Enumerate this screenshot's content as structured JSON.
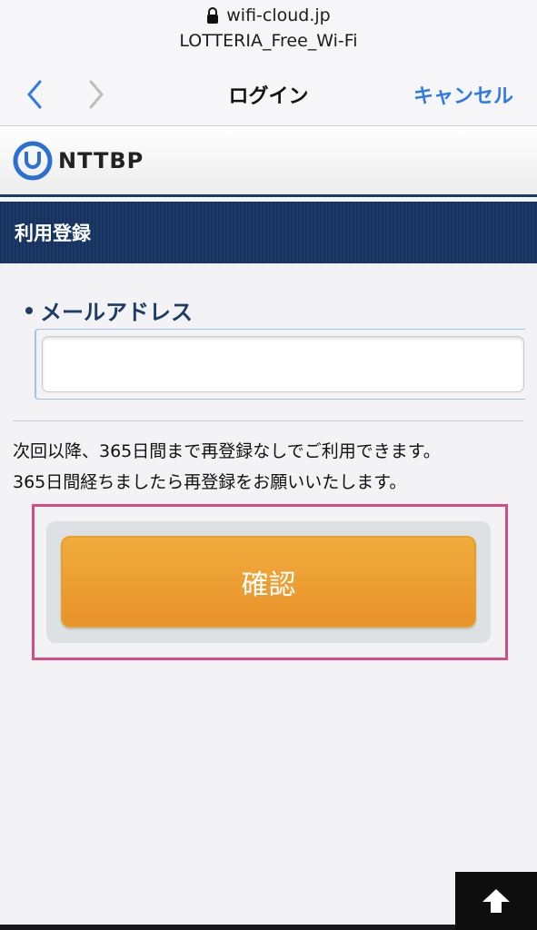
{
  "browser": {
    "url": "wifi-cloud.jp",
    "site_title": "LOTTERIA_Free_Wi-Fi",
    "nav_title": "ログイン",
    "cancel_label": "キャンセル"
  },
  "brand": {
    "name": "NTTBP"
  },
  "section": {
    "title": "利用登録"
  },
  "form": {
    "email_label": "メールアドレス",
    "email_value": "",
    "notice_line1": "次回以降、365日間まで再登録なしでご利用できます。",
    "notice_line2": "365日間経ちましたら再登録をお願いいたします。",
    "confirm_label": "確認"
  },
  "colors": {
    "accent_blue": "#2f7ae5",
    "navy": "#1b3a68",
    "button_orange": "#eb9b31",
    "highlight_pink": "#d54c86"
  },
  "icons": {
    "lock": "lock-icon",
    "back": "chevron-left-icon",
    "forward": "chevron-right-icon",
    "logo": "nttbp-logo-icon",
    "scroll_top": "arrow-up-icon"
  }
}
